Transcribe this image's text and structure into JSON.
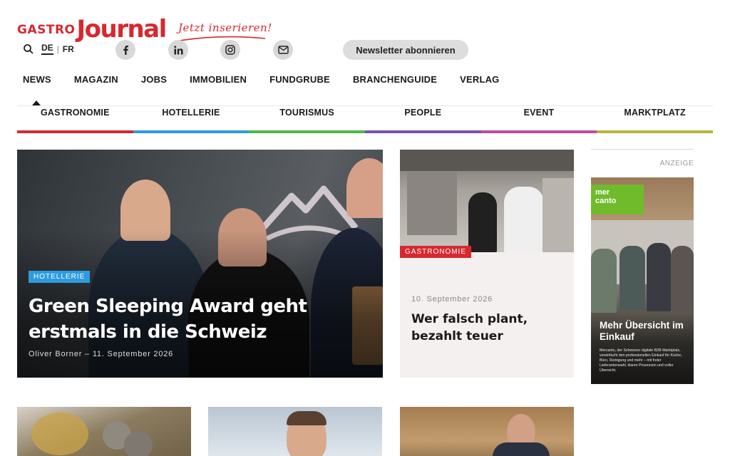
{
  "logo": {
    "part1": "GASTRO",
    "part2": "Journal"
  },
  "header": {
    "cta": "Jetzt inserieren!",
    "languages": [
      "DE",
      "FR"
    ],
    "active_language": "DE",
    "newsletter": "Newsletter abonnieren",
    "social": [
      "facebook-icon",
      "linkedin-icon",
      "instagram-icon",
      "mail-icon"
    ]
  },
  "nav": {
    "items": [
      "NEWS",
      "MAGAZIN",
      "JOBS",
      "IMMOBILIEN",
      "FUNDGRUBE",
      "BRANCHENGUIDE",
      "VERLAG"
    ],
    "active": "NEWS"
  },
  "subnav": {
    "items": [
      {
        "label": "GASTRONOMIE",
        "color": "#d7282f"
      },
      {
        "label": "HOTELLERIE",
        "color": "#2d9be0"
      },
      {
        "label": "TOURISMUS",
        "color": "#4cb848"
      },
      {
        "label": "PEOPLE",
        "color": "#7b4fb0"
      },
      {
        "label": "EVENT",
        "color": "#c24a9e"
      },
      {
        "label": "MARKTPLATZ",
        "color": "#b8b53a"
      }
    ]
  },
  "hero": {
    "tag": "HOTELLERIE",
    "tag_color": "#2d9be0",
    "title": "Green Sleeping Award geht erstmals in die Schweiz",
    "meta": "Oliver Borner – 11. September 2026"
  },
  "card": {
    "tag": "GASTRONOMIE",
    "tag_color": "#d7282f",
    "date": "10. September 2026",
    "title": "Wer falsch plant, bezahlt teuer"
  },
  "ad": {
    "label": "ANZEIGE",
    "brand_line1": "mer",
    "brand_line2": "canto",
    "title": "Mehr Übersicht im Einkauf",
    "text": "Mercanto, der Schweizer digitale B2B-Marktplatz, vereinfacht den professionellen Einkauf für Küche, Büro, Reinigung und mehr – mit freier Lieferantenwahl, klaren Prozessen und voller Übersicht."
  }
}
